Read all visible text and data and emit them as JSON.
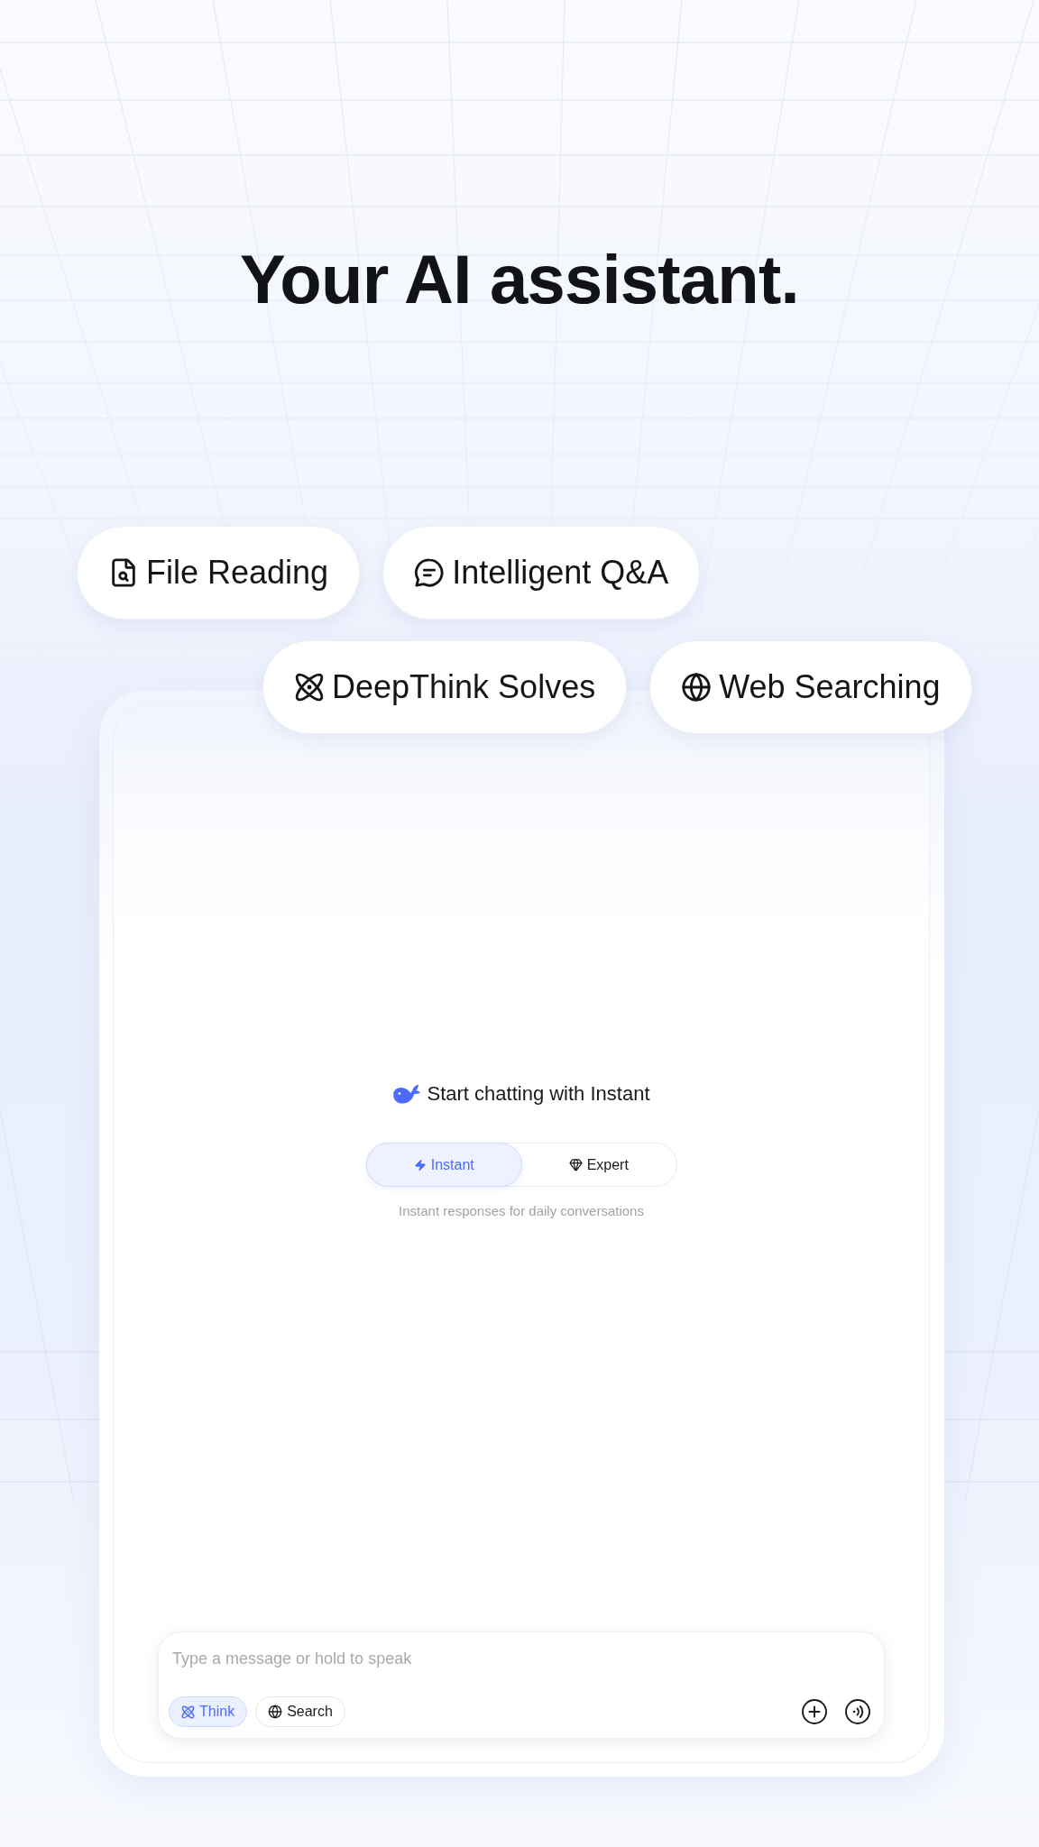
{
  "headline": "Your AI assistant.",
  "features": [
    {
      "label": "File Reading"
    },
    {
      "label": "Intelligent Q&A"
    },
    {
      "label": "DeepThink Solves"
    },
    {
      "label": "Web Searching"
    }
  ],
  "chat": {
    "title": "Start chatting with Instant",
    "modes": [
      {
        "label": "Instant",
        "selected": true
      },
      {
        "label": "Expert",
        "selected": false
      }
    ],
    "mode_description": "Instant responses for daily conversations",
    "composer": {
      "placeholder": "Type a message or hold to speak",
      "toggles": [
        {
          "label": "Think",
          "selected": true
        },
        {
          "label": "Search",
          "selected": false
        }
      ]
    }
  }
}
